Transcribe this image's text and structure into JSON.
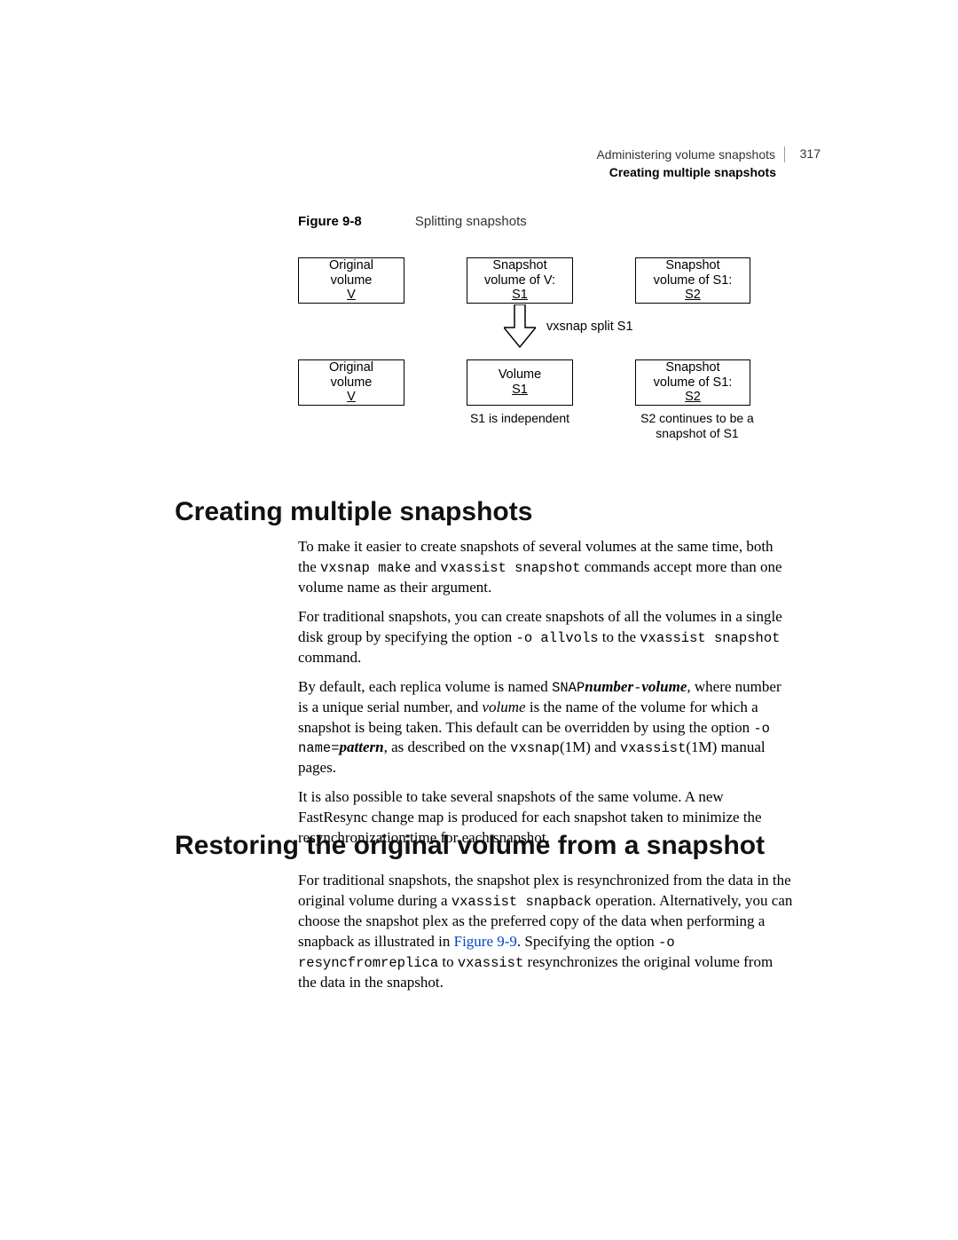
{
  "header": {
    "chapter": "Administering volume snapshots",
    "section": "Creating multiple snapshots",
    "page_number": "317"
  },
  "figure": {
    "label": "Figure 9-8",
    "title": "Splitting snapshots",
    "boxes": {
      "orig_top": "Original\nvolume",
      "orig_top_sub": "V",
      "snap_top_mid": "Snapshot\nvolume of V:",
      "snap_top_mid_sub": "S1",
      "snap_top_right": "Snapshot\nvolume of S1:",
      "snap_top_right_sub": "S2",
      "orig_bot": "Original\nvolume",
      "orig_bot_sub": "V",
      "vol_bot_mid": "Volume",
      "vol_bot_mid_sub": "S1",
      "snap_bot_right": "Snapshot\nvolume of S1:",
      "snap_bot_right_sub": "S2"
    },
    "command": "vxsnap split S1",
    "caption_mid": "S1 is independent",
    "caption_right": "S2 continues to be a\nsnapshot of S1"
  },
  "sections": {
    "h1_a": "Creating multiple snapshots",
    "p1_a": "To make it easier to create snapshots of several volumes at the same time, both the ",
    "p1_b": "vxsnap make",
    "p1_c": " and ",
    "p1_d": "vxassist snapshot",
    "p1_e": " commands accept more than one volume name as their argument.",
    "p2_a": "For traditional snapshots, you can create snapshots of all the volumes in a single disk group by specifying the option ",
    "p2_b": "-o allvols",
    "p2_c": " to the ",
    "p2_d": "vxassist snapshot",
    "p2_e": " command.",
    "p3_a": "By default, each replica volume is named ",
    "p3_b": "SNAP",
    "p3_c": "number",
    "p3_d": "-",
    "p3_e": "volume",
    "p3_f": ", where number is a unique serial number, and ",
    "p3_g": "volume",
    "p3_h": " is the name of the volume for which a snapshot is being taken. This default can be overridden by using the option ",
    "p3_i": "-o name=",
    "p3_j": "pattern",
    "p3_k": ", as described on the ",
    "p3_l": "vxsnap",
    "p3_m": "(1M) and ",
    "p3_n": "vxassist",
    "p3_o": "(1M) manual pages.",
    "p4": "It is also possible to take several snapshots of the same volume. A new FastResync change map is produced for each snapshot taken to minimize the resynchronization time for each snapshot.",
    "h1_b": "Restoring the original volume from a snapshot",
    "p5_a": "For traditional snapshots, the snapshot plex is resynchronized from the data in the original volume during a ",
    "p5_b": "vxassist snapback",
    "p5_c": " operation. Alternatively, you can choose the snapshot plex as the preferred copy of the data when performing a snapback as illustrated in ",
    "p5_d": "Figure 9-9",
    "p5_e": ". Specifying the option ",
    "p5_f": "-o resyncfromreplica",
    "p5_g": " to ",
    "p5_h": "vxassist",
    "p5_i": " resynchronizes the original volume from the data in the snapshot."
  }
}
